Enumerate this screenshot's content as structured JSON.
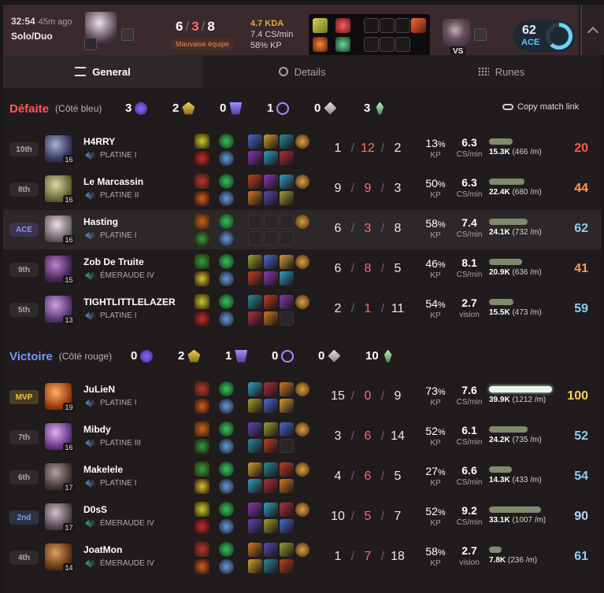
{
  "colors": {
    "accent_lose": "#ff5a5a",
    "accent_win": "#7a9aff",
    "ace": "#5ec8f5",
    "mvp": "#f0c050"
  },
  "header": {
    "time": "32:54",
    "ago": "45m ago",
    "queue": "Solo/Duo",
    "kda_k": "6",
    "kda_d": "3",
    "kda_a": "8",
    "tag": "Mauvaise équipe",
    "kda_ratio": "4.7 KDA",
    "cs_min": "7.4 CS/min",
    "kp": "58% KP",
    "vs": "VS",
    "ace_score": "62",
    "ace_label": "ACE",
    "ace_fraction": 0.62
  },
  "tabs": [
    {
      "label": "General",
      "icon": "list-icon"
    },
    {
      "label": "Details",
      "icon": "chart-icon"
    },
    {
      "label": "Runes",
      "icon": "grid-icon"
    }
  ],
  "copy_link": "Copy match link",
  "teams": {
    "blue": {
      "result": "Défaite",
      "side": "(Côté bleu)",
      "objectives": [
        "3",
        "2",
        "0",
        "1",
        "0",
        "3"
      ]
    },
    "red": {
      "result": "Victoire",
      "side": "(Côté rouge)",
      "objectives": [
        "0",
        "2",
        "1",
        "0",
        "0",
        "10"
      ]
    }
  },
  "players": [
    {
      "rank": "10th",
      "name": "H4RRY",
      "tier": "PLATINE I",
      "level": "16",
      "k": "1",
      "d": "12",
      "a": "2",
      "kp": "13",
      "cs": "6.3",
      "cs_label": "CS/min",
      "dmg": "15.3K",
      "dmg_min": "(466 /m)",
      "dmg_frac": 0.38,
      "score": "20",
      "score_color": "#ff5a4a"
    },
    {
      "rank": "8th",
      "name": "Le Marcassin",
      "tier": "PLATINE II",
      "level": "16",
      "k": "9",
      "d": "9",
      "a": "3",
      "kp": "50",
      "cs": "6.3",
      "cs_label": "CS/min",
      "dmg": "22.4K",
      "dmg_min": "(680 /m)",
      "dmg_frac": 0.56,
      "score": "44",
      "score_color": "#ff9a50"
    },
    {
      "rank": "ACE",
      "name": "Hasting",
      "tier": "PLATINE I",
      "level": "16",
      "k": "6",
      "d": "3",
      "a": "8",
      "kp": "58",
      "cs": "7.4",
      "cs_label": "CS/min",
      "dmg": "24.1K",
      "dmg_min": "(732 /m)",
      "dmg_frac": 0.61,
      "score": "62",
      "score_color": "#8ecff0"
    },
    {
      "rank": "9th",
      "name": "Zob De Truite",
      "tier": "ÉMERAUDE IV",
      "level": "15",
      "k": "6",
      "d": "8",
      "a": "5",
      "kp": "46",
      "cs": "8.1",
      "cs_label": "CS/min",
      "dmg": "20.9K",
      "dmg_min": "(636 /m)",
      "dmg_frac": 0.52,
      "score": "41",
      "score_color": "#ff9a50"
    },
    {
      "rank": "5th",
      "name": "TIGHTLITTLELAZER",
      "tier": "PLATINE I",
      "level": "13",
      "k": "2",
      "d": "1",
      "a": "11",
      "kp": "54",
      "cs": "2.7",
      "cs_label": "vision",
      "dmg": "15.5K",
      "dmg_min": "(473 /m)",
      "dmg_frac": 0.39,
      "score": "59",
      "score_color": "#8ecff0"
    },
    {
      "rank": "MVP",
      "name": "JuLieN",
      "tier": "PLATINE I",
      "level": "19",
      "k": "15",
      "d": "0",
      "a": "9",
      "kp": "73",
      "cs": "7.6",
      "cs_label": "CS/min",
      "dmg": "39.9K",
      "dmg_min": "(1212 /m)",
      "dmg_frac": 1.0,
      "score": "100",
      "score_color": "#f6d060"
    },
    {
      "rank": "7th",
      "name": "Mibdy",
      "tier": "PLATINE III",
      "level": "16",
      "k": "3",
      "d": "6",
      "a": "14",
      "kp": "52",
      "cs": "6.1",
      "cs_label": "CS/min",
      "dmg": "24.2K",
      "dmg_min": "(735 /m)",
      "dmg_frac": 0.61,
      "score": "52",
      "score_color": "#8ecff0"
    },
    {
      "rank": "6th",
      "name": "Makelele",
      "tier": "PLATINE I",
      "level": "17",
      "k": "4",
      "d": "6",
      "a": "5",
      "kp": "27",
      "cs": "6.6",
      "cs_label": "CS/min",
      "dmg": "14.3K",
      "dmg_min": "(433 /m)",
      "dmg_frac": 0.36,
      "score": "54",
      "score_color": "#8ecff0"
    },
    {
      "rank": "2nd",
      "name": "D0sS",
      "tier": "ÉMERAUDE IV",
      "level": "17",
      "k": "10",
      "d": "5",
      "a": "7",
      "kp": "52",
      "cs": "9.2",
      "cs_label": "CS/min",
      "dmg": "33.1K",
      "dmg_min": "(1007 /m)",
      "dmg_frac": 0.83,
      "score": "90",
      "score_color": "#b4d8f4"
    },
    {
      "rank": "4th",
      "name": "JoatMon",
      "tier": "ÉMERAUDE IV",
      "level": "14",
      "k": "1",
      "d": "7",
      "a": "18",
      "kp": "58",
      "cs": "2.7",
      "cs_label": "vision",
      "dmg": "7.8K",
      "dmg_min": "(236 /m)",
      "dmg_frac": 0.2,
      "score": "61",
      "score_color": "#8ecff0"
    }
  ]
}
